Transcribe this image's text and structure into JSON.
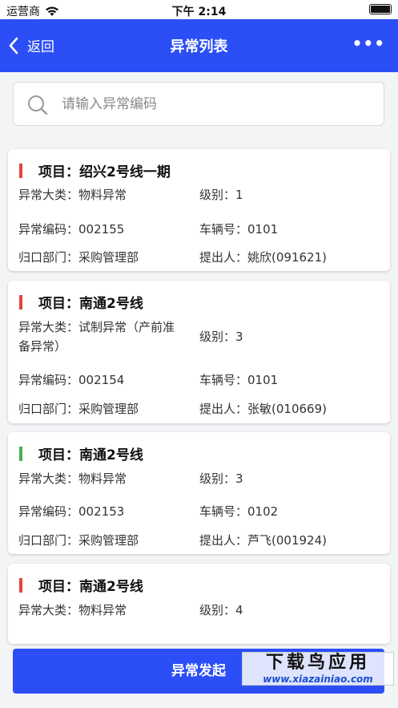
{
  "status_bar": {
    "carrier": "运营商",
    "time": "下午 2:14"
  },
  "navbar": {
    "back_label": "返回",
    "title": "异常列表",
    "more_icon": "more-dots-icon"
  },
  "search": {
    "placeholder": "请输入异常编码"
  },
  "colors": {
    "primary": "#2b4ef6",
    "red_flag": "#e5453a",
    "green_flag": "#4caf50"
  },
  "cards": [
    {
      "flag": "red",
      "project": "项目：绍兴2号线一期",
      "category_label": "异常大类：",
      "category": "物料异常",
      "level_label": "级别：",
      "level": "1",
      "code_label": "异常编码：",
      "code": "002155",
      "vehicle_label": "车辆号：",
      "vehicle": "0101",
      "dept_label": "归口部门：",
      "dept": "采购管理部",
      "submitter_label": "提出人：",
      "submitter": "姚欣(091621)"
    },
    {
      "flag": "red",
      "project": "项目：南通2号线",
      "category_label": "异常大类：",
      "category": "试制异常（产前准",
      "category_cont": "备异常）",
      "level_label": "级别：",
      "level": "3",
      "code_label": "异常编码：",
      "code": "002154",
      "vehicle_label": "车辆号：",
      "vehicle": "0101",
      "dept_label": "归口部门：",
      "dept": "采购管理部",
      "submitter_label": "提出人：",
      "submitter": "张敏(010669)"
    },
    {
      "flag": "green",
      "project": "项目：南通2号线",
      "category_label": "异常大类：",
      "category": "物料异常",
      "level_label": "级别：",
      "level": "3",
      "code_label": "异常编码：",
      "code": "002153",
      "vehicle_label": "车辆号：",
      "vehicle": "0102",
      "dept_label": "归口部门：",
      "dept": "采购管理部",
      "submitter_label": "提出人：",
      "submitter": "芦飞(001924)"
    },
    {
      "flag": "red",
      "project": "项目：南通2号线",
      "category_label": "异常大类：",
      "category": "物料异常",
      "level_label": "级别：",
      "level": "4"
    }
  ],
  "bottom_button": {
    "label": "异常发起"
  },
  "watermark": {
    "title": "下载鸟应用",
    "url": "www.xiazainiao.com"
  }
}
